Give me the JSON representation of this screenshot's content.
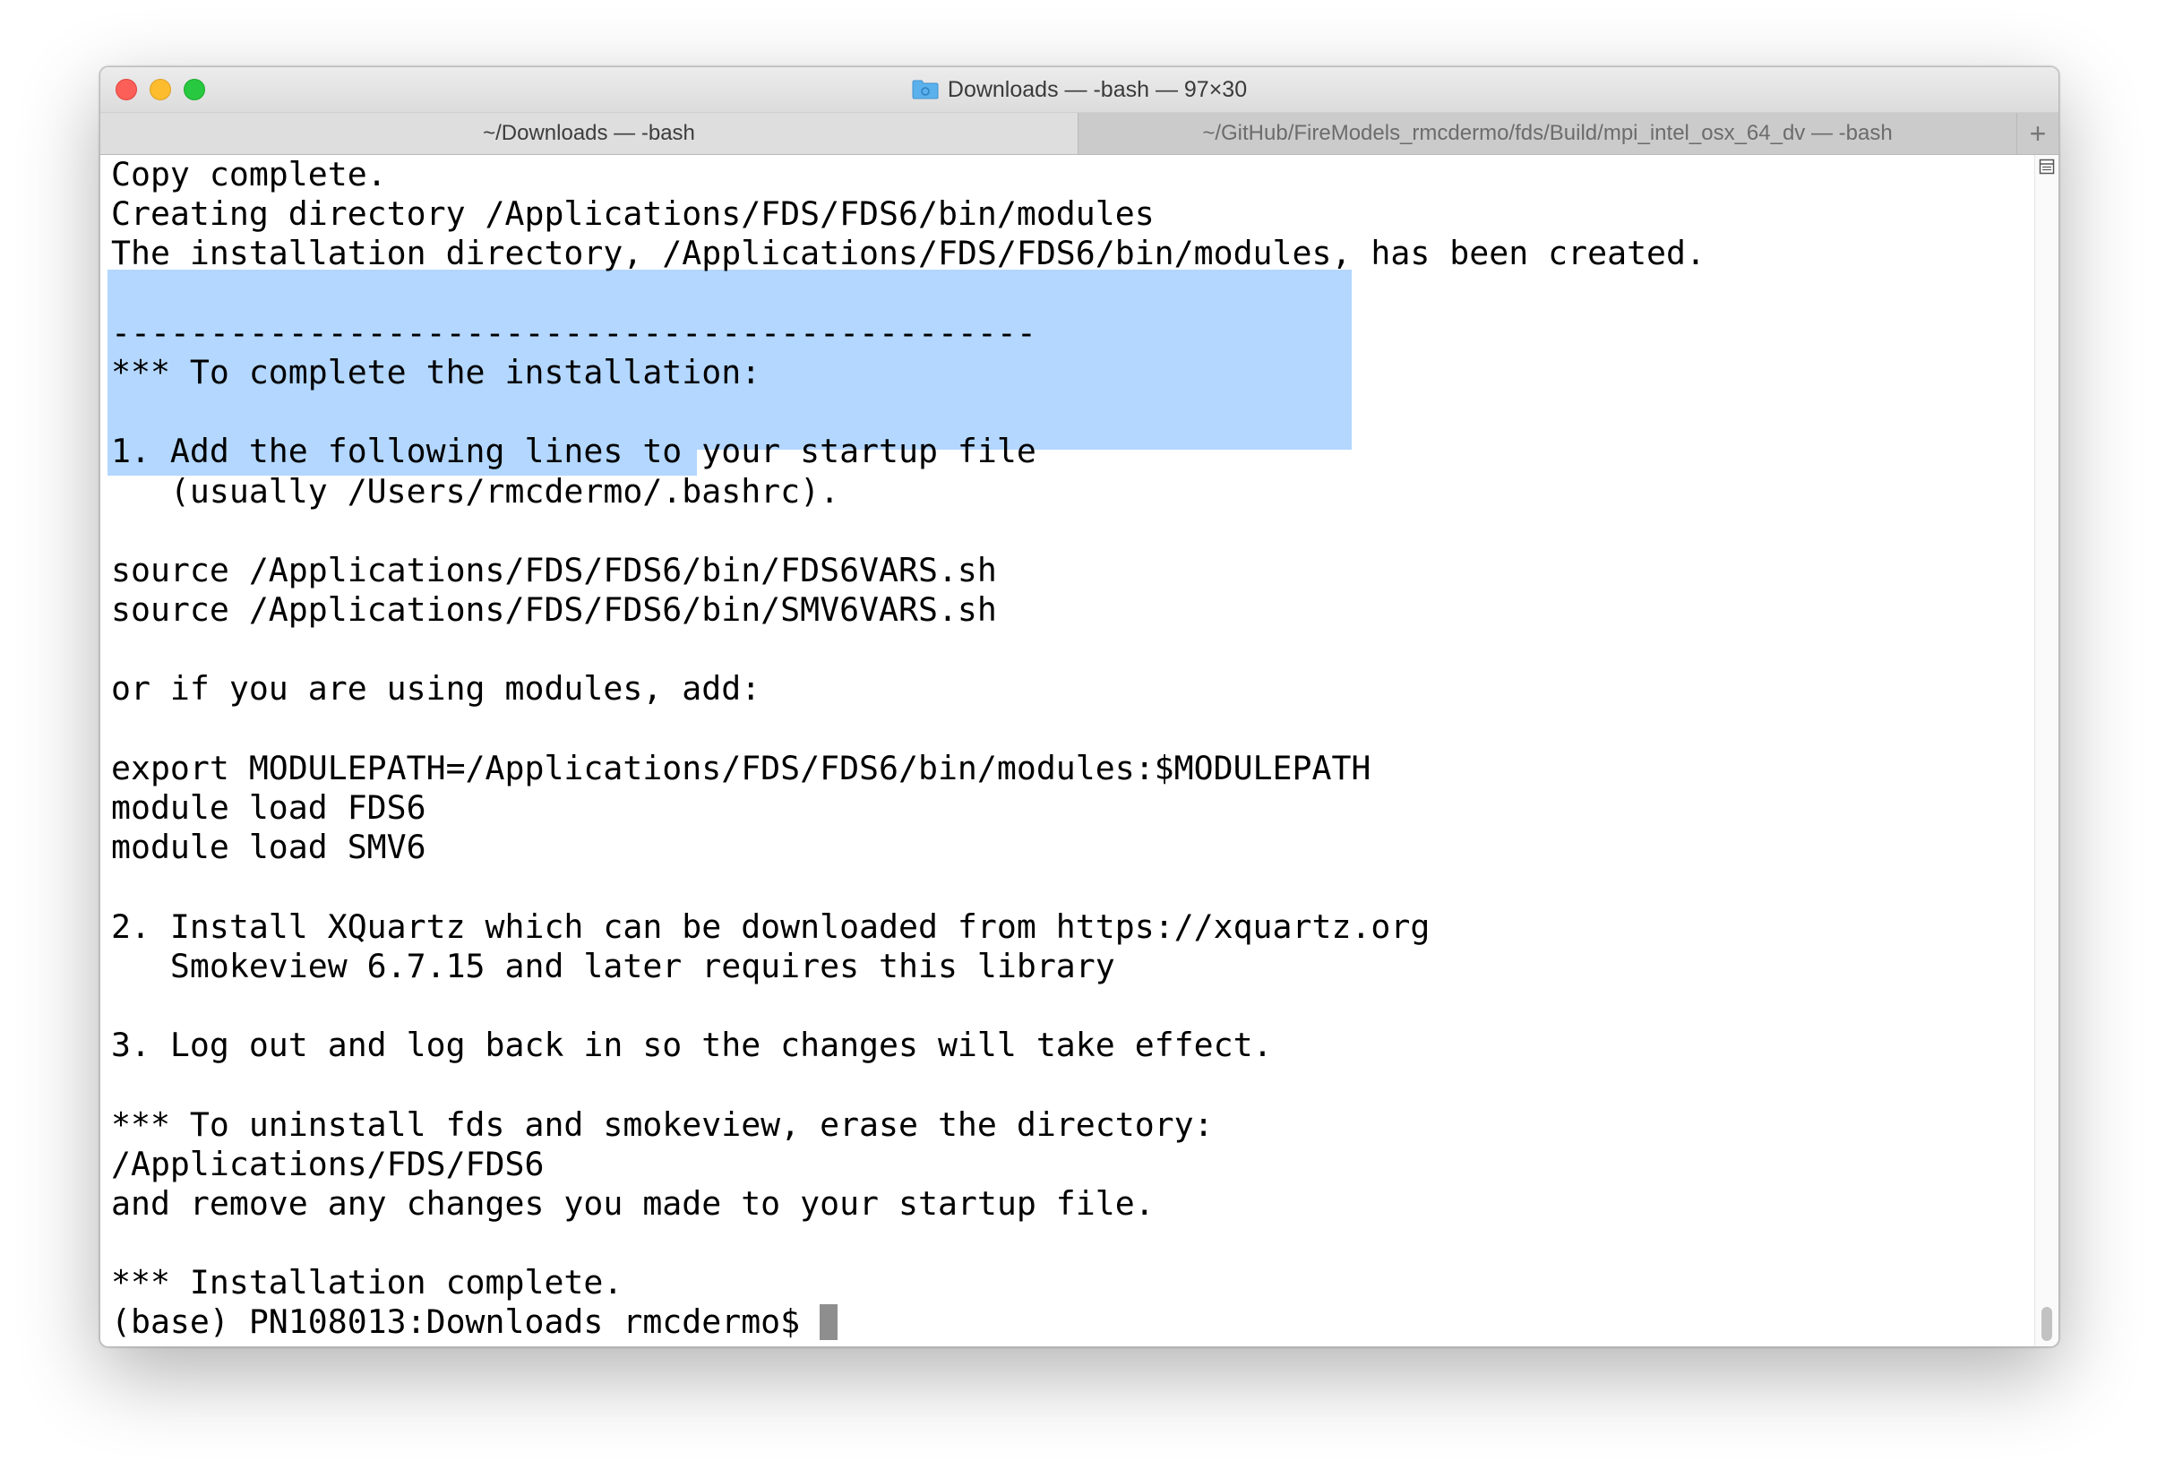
{
  "window": {
    "title": "Downloads — -bash — 97×30"
  },
  "tabs": [
    {
      "label": "~/Downloads — -bash",
      "active": true
    },
    {
      "label": "~/GitHub/FireModels_rmcdermo/fds/Build/mpi_intel_osx_64_dv — -bash",
      "active": false
    }
  ],
  "new_tab_label": "+",
  "terminal": {
    "lines": [
      "Copy complete.",
      "Creating directory /Applications/FDS/FDS6/bin/modules",
      "The installation directory, /Applications/FDS/FDS6/bin/modules, has been created.",
      "",
      "-----------------------------------------------",
      "*** To complete the installation:",
      "",
      "1. Add the following lines to your startup file",
      "   (usually /Users/rmcdermo/.bashrc).",
      "",
      "source /Applications/FDS/FDS6/bin/FDS6VARS.sh",
      "source /Applications/FDS/FDS6/bin/SMV6VARS.sh",
      "",
      "or if you are using modules, add:",
      "",
      "export MODULEPATH=/Applications/FDS/FDS6/bin/modules:$MODULEPATH",
      "module load FDS6",
      "module load SMV6",
      "",
      "2. Install XQuartz which can be downloaded from https://xquartz.org",
      "   Smokeview 6.7.15 and later requires this library",
      "",
      "3. Log out and log back in so the changes will take effect.",
      "",
      "*** To uninstall fds and smokeview, erase the directory:",
      "/Applications/FDS/FDS6",
      "and remove any changes you made to your startup file.",
      "",
      "*** Installation complete."
    ],
    "prompt": "(base) PN108013:Downloads rmcdermo$"
  },
  "colors": {
    "selection": "#b3d7ff",
    "cursor": "#8e8e8e",
    "close": "#fc5f57",
    "minimize": "#fdbc2e",
    "maximize": "#28c840"
  }
}
